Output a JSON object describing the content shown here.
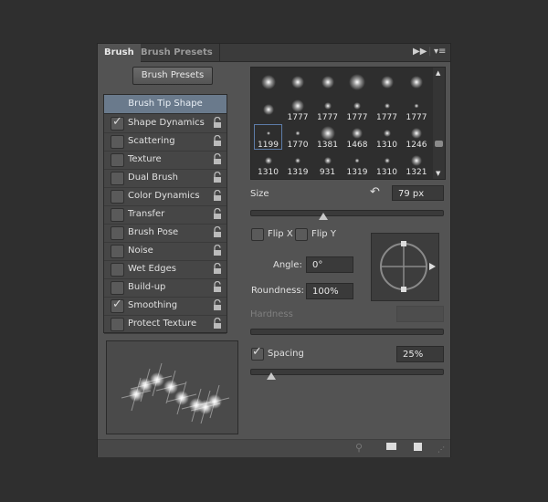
{
  "tabs": [
    {
      "label": "Brush",
      "active": true
    },
    {
      "label": "Brush Presets",
      "active": false
    }
  ],
  "toolbar": {
    "collapse_icon": "double-arrow-icon",
    "menu_icon": "panel-menu-icon"
  },
  "presets_button": "Brush Presets",
  "options_header": "Brush Tip Shape",
  "options": [
    {
      "label": "Shape Dynamics",
      "checked": true
    },
    {
      "label": "Scattering",
      "checked": false
    },
    {
      "label": "Texture",
      "checked": false
    },
    {
      "label": "Dual Brush",
      "checked": false
    },
    {
      "label": "Color Dynamics",
      "checked": false
    },
    {
      "label": "Transfer",
      "checked": false
    },
    {
      "label": "Brush Pose",
      "checked": false
    },
    {
      "label": "Noise",
      "checked": false
    },
    {
      "label": "Wet Edges",
      "checked": false
    },
    {
      "label": "Build-up",
      "checked": false
    },
    {
      "label": "Smoothing",
      "checked": true
    },
    {
      "label": "Protect Texture",
      "checked": false
    }
  ],
  "brush_tips": [
    {
      "num": "",
      "size": 16
    },
    {
      "num": "",
      "size": 14
    },
    {
      "num": "",
      "size": 14
    },
    {
      "num": "",
      "size": 18
    },
    {
      "num": "",
      "size": 14
    },
    {
      "num": "",
      "size": 14
    },
    {
      "num": "",
      "size": 12
    },
    {
      "num": "1777",
      "size": 14
    },
    {
      "num": "1777",
      "size": 8
    },
    {
      "num": "1777",
      "size": 8
    },
    {
      "num": "1777",
      "size": 6
    },
    {
      "num": "1777",
      "size": 5
    },
    {
      "num": "1199",
      "size": 4,
      "selected": true
    },
    {
      "num": "1770",
      "size": 5
    },
    {
      "num": "1381",
      "size": 16
    },
    {
      "num": "1468",
      "size": 12
    },
    {
      "num": "1310",
      "size": 8
    },
    {
      "num": "1246",
      "size": 12
    },
    {
      "num": "1310",
      "size": 8
    },
    {
      "num": "1319",
      "size": 6
    },
    {
      "num": "931",
      "size": 8
    },
    {
      "num": "1319",
      "size": 5
    },
    {
      "num": "1310",
      "size": 6
    },
    {
      "num": "1321",
      "size": 12
    }
  ],
  "size": {
    "label": "Size",
    "value": "79 px",
    "slider_fraction": 0.38
  },
  "flip_x": {
    "label": "Flip X",
    "checked": false
  },
  "flip_y": {
    "label": "Flip Y",
    "checked": false
  },
  "angle": {
    "label": "Angle:",
    "value": "0°"
  },
  "roundness": {
    "label": "Roundness:",
    "value": "100%"
  },
  "hardness": {
    "label": "Hardness",
    "value": "",
    "disabled": true
  },
  "spacing": {
    "label": "Spacing",
    "checked": true,
    "value": "25%",
    "slider_fraction": 0.11
  },
  "footer_icons": [
    "brush-pressure-icon",
    "create-brush-icon",
    "new-preset-icon"
  ]
}
